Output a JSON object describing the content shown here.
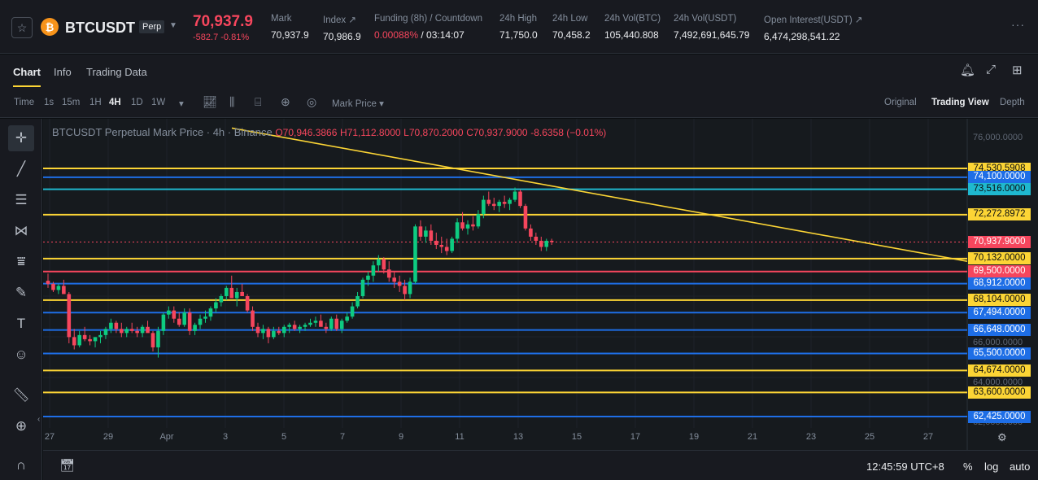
{
  "ticker": {
    "star_icon": "star-icon",
    "coin_icon": "bitcoin-icon",
    "coin_glyph": "₿",
    "symbol": "BTCUSDT",
    "badge": "Perp",
    "last_price": "70,937.9",
    "change": "-582.7",
    "change_pct": "-0.81%",
    "mark_label": "Mark",
    "mark_value": "70,937.9",
    "index_label": "Index",
    "index_value": "70,986.9",
    "funding_label": "Funding (8h) / Countdown",
    "funding_rate": "0.00088%",
    "funding_countdown": "/ 03:14:07",
    "high_label": "24h High",
    "high_value": "71,750.0",
    "low_label": "24h Low",
    "low_value": "70,458.2",
    "vol_btc_label": "24h Vol(BTC)",
    "vol_btc_value": "105,440.808",
    "vol_usdt_label": "24h Vol(USDT)",
    "vol_usdt_value": "7,492,691,645.79",
    "oi_label": "Open Interest(USDT)",
    "oi_value": "6,474,298,541.22",
    "more_icon": "more-icon"
  },
  "tabs": {
    "chart": "Chart",
    "info": "Info",
    "trading_data": "Trading Data"
  },
  "toolbar": {
    "time": "Time",
    "intervals": [
      "1s",
      "15m",
      "1H",
      "4H",
      "1D",
      "1W"
    ],
    "active_interval": "4H",
    "price_type": "Mark Price",
    "views": [
      "Original",
      "Trading View",
      "Depth"
    ],
    "active_view": "Trading View"
  },
  "legend": {
    "title": "BTCUSDT Perpetual Mark Price · 4h · Binance",
    "open": "O70,946.3866",
    "high": "H71,112.8000",
    "low": "L70,870.2000",
    "close": "C70,937.9000",
    "change": "-8.6358 (−0.01%)"
  },
  "price_axis_ticks": [
    "76,000.0000",
    "66,000.0000",
    "64,000.0000",
    "62,000.0000"
  ],
  "levels": [
    {
      "label": "74,530.5908",
      "color": "yellow",
      "price": 74530.5908
    },
    {
      "label": "74,100.0000",
      "color": "blue",
      "price": 74100
    },
    {
      "label": "73,516.0000",
      "color": "cyan",
      "price": 73516
    },
    {
      "label": "72,272.8972",
      "color": "yellow",
      "price": 72272.8972
    },
    {
      "label": "70,937.9000",
      "color": "red",
      "price": 70937.9
    },
    {
      "label": "70,132.0000",
      "color": "yellow",
      "price": 70132
    },
    {
      "label": "69,500.0000",
      "color": "red",
      "price": 69500
    },
    {
      "label": "68,912.0000",
      "color": "blue",
      "price": 68912
    },
    {
      "label": "68,104.0000",
      "color": "yellow",
      "price": 68104
    },
    {
      "label": "67,494.0000",
      "color": "blue",
      "price": 67494
    },
    {
      "label": "66,648.0000",
      "color": "blue",
      "price": 66648
    },
    {
      "label": "65,500.0000",
      "color": "blue",
      "price": 65500
    },
    {
      "label": "64,674.0000",
      "color": "yellow",
      "price": 64674
    },
    {
      "label": "63,600.0000",
      "color": "yellow",
      "price": 63600
    },
    {
      "label": "62,425.0000",
      "color": "blue",
      "price": 62425
    }
  ],
  "colors": {
    "up": "#0ecb81",
    "down": "#f6465d",
    "yellow": "#fcd535",
    "blue": "#1e6ee6",
    "cyan": "#1fb8cf",
    "red": "#f6465d"
  },
  "dates": [
    "27",
    "29",
    "Apr",
    "3",
    "5",
    "7",
    "9",
    "11",
    "13",
    "15",
    "17",
    "19",
    "21",
    "23",
    "25",
    "27"
  ],
  "bottom": {
    "clock": "12:45:59 UTC+8",
    "pct": "%",
    "log": "log",
    "auto": "auto"
  },
  "chart_data": {
    "type": "candlestick",
    "interval": "4h",
    "last_close": 70937.9,
    "candles": [
      [
        69050,
        69400,
        68700,
        68900
      ],
      [
        68900,
        69000,
        68500,
        68600
      ],
      [
        68600,
        68900,
        68400,
        68800
      ],
      [
        68800,
        69100,
        68600,
        68400
      ],
      [
        68400,
        68500,
        66000,
        66300
      ],
      [
        66300,
        66700,
        65700,
        65900
      ],
      [
        65900,
        66600,
        65800,
        66400
      ],
      [
        66400,
        66800,
        66100,
        66200
      ],
      [
        66200,
        66400,
        65900,
        66100
      ],
      [
        66100,
        66300,
        65800,
        66300
      ],
      [
        66300,
        66600,
        66000,
        66400
      ],
      [
        66400,
        66800,
        66200,
        66700
      ],
      [
        66700,
        67200,
        66500,
        67000
      ],
      [
        67000,
        67100,
        66500,
        66700
      ],
      [
        66700,
        67000,
        66300,
        66500
      ],
      [
        66500,
        66800,
        66300,
        66700
      ],
      [
        66700,
        67000,
        66500,
        66600
      ],
      [
        66600,
        66800,
        66300,
        66500
      ],
      [
        66500,
        66900,
        66300,
        66800
      ],
      [
        66800,
        67100,
        66600,
        66500
      ],
      [
        66500,
        66600,
        65600,
        65800
      ],
      [
        65800,
        66800,
        65300,
        66600
      ],
      [
        66600,
        67500,
        66400,
        67400
      ],
      [
        67400,
        67800,
        67200,
        67600
      ],
      [
        67600,
        67800,
        67000,
        67200
      ],
      [
        67200,
        67500,
        66800,
        66900
      ],
      [
        66900,
        67700,
        66800,
        67500
      ],
      [
        67500,
        67700,
        66400,
        66600
      ],
      [
        66600,
        67000,
        66400,
        66900
      ],
      [
        66900,
        67400,
        66700,
        67200
      ],
      [
        67200,
        67600,
        67000,
        67300
      ],
      [
        67300,
        67800,
        67100,
        67700
      ],
      [
        67700,
        68200,
        67500,
        68000
      ],
      [
        68000,
        68400,
        67800,
        68300
      ],
      [
        68300,
        68800,
        68100,
        68700
      ],
      [
        68700,
        69300,
        68300,
        68200
      ],
      [
        68200,
        68700,
        67800,
        68500
      ],
      [
        68500,
        68900,
        68300,
        68300
      ],
      [
        68300,
        68400,
        67500,
        67600
      ],
      [
        67600,
        67800,
        66600,
        66800
      ],
      [
        66800,
        67000,
        66300,
        66500
      ],
      [
        66500,
        66900,
        66200,
        66700
      ],
      [
        66700,
        66800,
        66000,
        66300
      ],
      [
        66300,
        66800,
        66200,
        66600
      ],
      [
        66600,
        66800,
        66400,
        66500
      ],
      [
        66500,
        66900,
        66300,
        66800
      ],
      [
        66800,
        67000,
        66500,
        66900
      ],
      [
        66900,
        67100,
        66600,
        66700
      ],
      [
        66700,
        66900,
        66500,
        66800
      ],
      [
        66800,
        67000,
        66600,
        66900
      ],
      [
        66900,
        67200,
        66800,
        67000
      ],
      [
        67000,
        67300,
        66800,
        67100
      ],
      [
        67100,
        67400,
        66900,
        66800
      ],
      [
        66800,
        67000,
        66500,
        66700
      ],
      [
        66700,
        67300,
        66600,
        67200
      ],
      [
        67200,
        67400,
        66600,
        66700
      ],
      [
        66700,
        67200,
        66500,
        67100
      ],
      [
        67100,
        67500,
        67000,
        67300
      ],
      [
        67300,
        68000,
        67200,
        67800
      ],
      [
        67800,
        68500,
        67700,
        68300
      ],
      [
        68300,
        69200,
        68200,
        69100
      ],
      [
        69100,
        69500,
        68800,
        69300
      ],
      [
        69300,
        70000,
        69000,
        69800
      ],
      [
        69800,
        70300,
        69500,
        70100
      ],
      [
        70100,
        70200,
        69400,
        69600
      ],
      [
        69600,
        70000,
        69000,
        69200
      ],
      [
        69200,
        69500,
        68700,
        69000
      ],
      [
        69000,
        69300,
        68500,
        68800
      ],
      [
        68800,
        69100,
        68100,
        68400
      ],
      [
        68400,
        69200,
        68200,
        69000
      ],
      [
        69000,
        71800,
        68900,
        71700
      ],
      [
        71700,
        72000,
        71000,
        71200
      ],
      [
        71200,
        71700,
        70900,
        71500
      ],
      [
        71500,
        71800,
        70800,
        71000
      ],
      [
        71000,
        71400,
        70600,
        70800
      ],
      [
        70800,
        71200,
        70400,
        70700
      ],
      [
        70700,
        71100,
        70300,
        70500
      ],
      [
        70500,
        71200,
        70400,
        71100
      ],
      [
        71100,
        72100,
        70900,
        71900
      ],
      [
        71900,
        72400,
        71500,
        71600
      ],
      [
        71600,
        72000,
        71300,
        71800
      ],
      [
        71800,
        72200,
        71500,
        71700
      ],
      [
        71700,
        72500,
        71600,
        72300
      ],
      [
        72300,
        73200,
        72100,
        73000
      ],
      [
        73000,
        73400,
        72700,
        72800
      ],
      [
        72800,
        73100,
        72500,
        72700
      ],
      [
        72700,
        73000,
        72400,
        72900
      ],
      [
        72900,
        73200,
        72600,
        72800
      ],
      [
        72800,
        73100,
        72500,
        73000
      ],
      [
        73000,
        73600,
        72900,
        73400
      ],
      [
        73400,
        73500,
        72600,
        72700
      ],
      [
        72700,
        72800,
        71500,
        71600
      ],
      [
        71600,
        71800,
        71000,
        71200
      ],
      [
        71200,
        71400,
        70800,
        71000
      ],
      [
        71000,
        71200,
        70500,
        70700
      ],
      [
        70700,
        71100,
        70500,
        71000
      ],
      [
        71000,
        71100,
        70800,
        70937.9
      ]
    ],
    "trendline": {
      "start_date": "Mar 29",
      "start_price": 76500,
      "end_date": "Apr 25",
      "end_price": 70000
    }
  }
}
